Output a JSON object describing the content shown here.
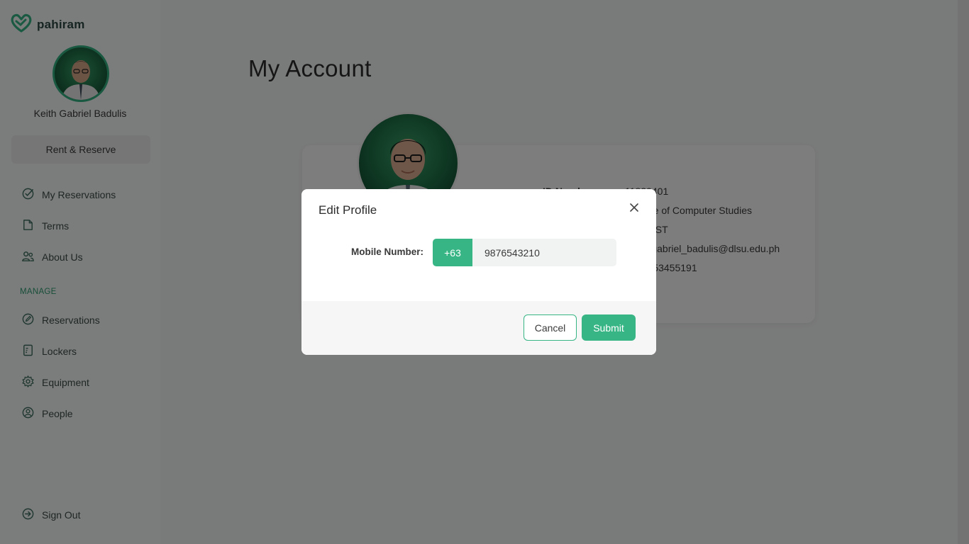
{
  "brand": {
    "name": "pahiram",
    "logo_icon": "heart-hands-logo",
    "accent": "#37b585"
  },
  "user": {
    "name": "Keith Gabriel Badulis"
  },
  "sidebar": {
    "primary_button": "Rent & Reserve",
    "items": [
      {
        "label": "My Reservations",
        "icon": "check-circle-icon"
      },
      {
        "label": "Terms",
        "icon": "document-icon"
      },
      {
        "label": "About Us",
        "icon": "people-icon"
      }
    ],
    "section_label": "MANAGE",
    "manage_items": [
      {
        "label": "Reservations",
        "icon": "pencil-circle-icon"
      },
      {
        "label": "Lockers",
        "icon": "locker-icon"
      },
      {
        "label": "Equipment",
        "icon": "gear-icon"
      },
      {
        "label": "People",
        "icon": "person-icon"
      }
    ],
    "sign_out": {
      "label": "Sign Out",
      "icon": "sign-out-icon"
    }
  },
  "main": {
    "title": "My Account",
    "profile": {
      "rows": [
        {
          "label": "ID Number",
          "value": "11839401"
        },
        {
          "label": "",
          "value": "College of Computer Studies"
        },
        {
          "label": "",
          "value": "BSCS-ST"
        },
        {
          "label": "",
          "value": "keith_gabriel_badulis@dlsu.edu.ph"
        },
        {
          "label": "",
          "value": "+639653455191"
        }
      ]
    }
  },
  "modal": {
    "title": "Edit Profile",
    "close_icon": "close-icon",
    "field_label": "Mobile Number:",
    "country_code": "+63",
    "mobile_value": "9876543210",
    "cancel_label": "Cancel",
    "submit_label": "Submit"
  }
}
